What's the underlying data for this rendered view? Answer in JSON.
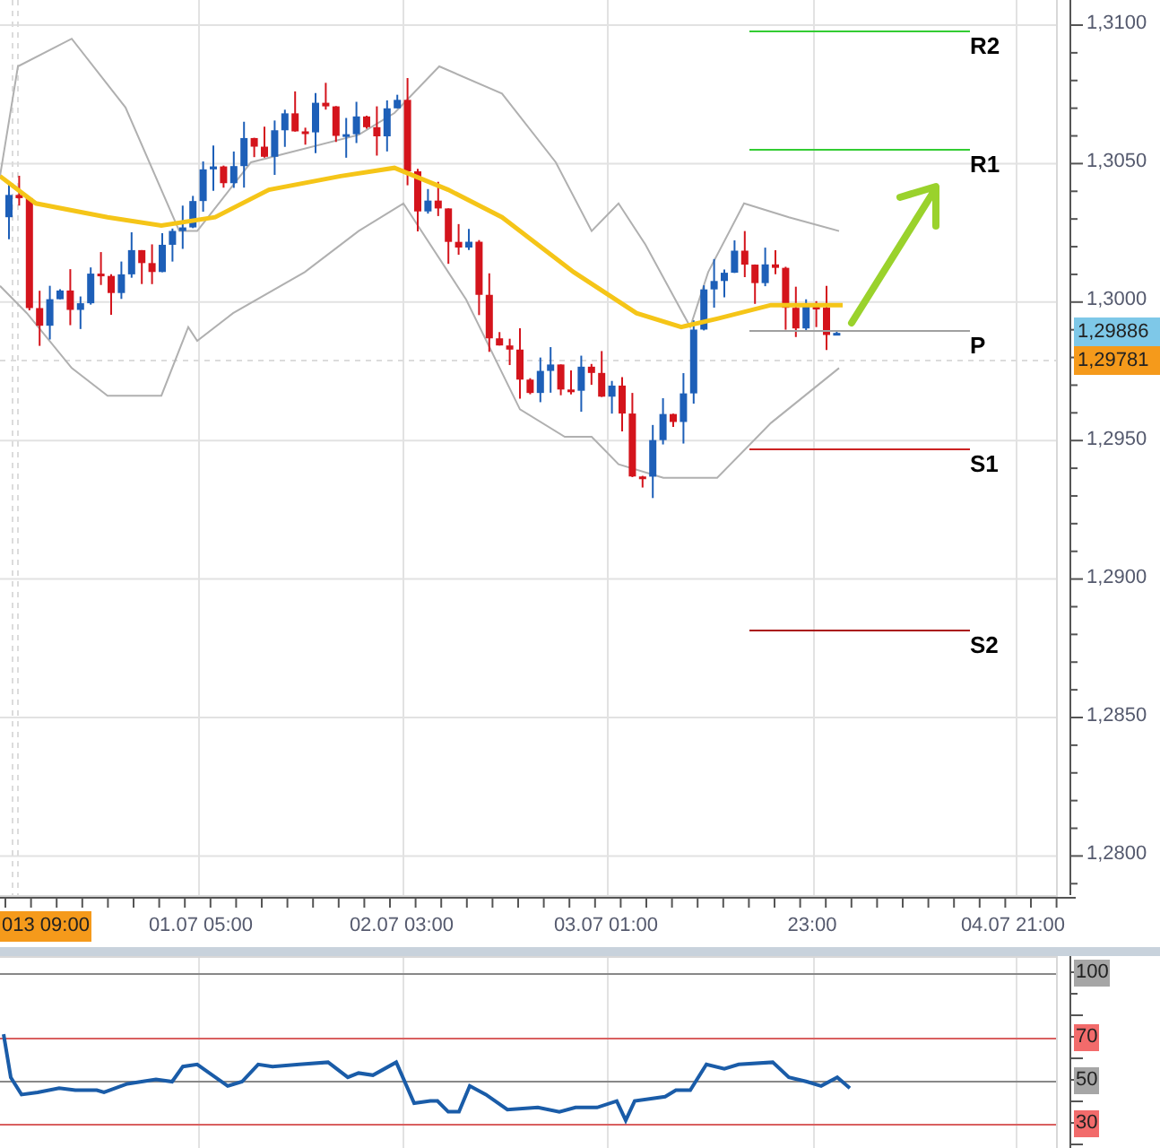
{
  "price_axis": {
    "labels": [
      "1,3100",
      "1,3050",
      "1,3000",
      "1,2950",
      "1,2900",
      "1,2850",
      "1,2800"
    ]
  },
  "price_tags": [
    {
      "text": "1,29886",
      "color": "#7ec8e8"
    },
    {
      "text": "1,29781",
      "color": "#f59a1b"
    }
  ],
  "pivot_levels": [
    {
      "label": "R2",
      "color": "#33cc33"
    },
    {
      "label": "R1",
      "color": "#33cc33"
    },
    {
      "label": "P",
      "color": "#a0a0a0"
    },
    {
      "label": "S1",
      "color": "#cc2222"
    },
    {
      "label": "S2",
      "color": "#aa1111"
    }
  ],
  "time_axis": {
    "labels": [
      {
        "text": "013 09:00",
        "selected": true
      },
      {
        "text": "01.07 05:00",
        "selected": false
      },
      {
        "text": "02.07 03:00",
        "selected": false
      },
      {
        "text": "03.07 01:00",
        "selected": false
      },
      {
        "text": "23:00",
        "selected": false
      },
      {
        "text": "04.07 21:00",
        "selected": false
      }
    ]
  },
  "rsi": {
    "labels": [
      {
        "text": "100",
        "color": "#a6a6a6"
      },
      {
        "text": "70",
        "color": "#f26b6b"
      },
      {
        "text": "50",
        "color": "#a6a6a6"
      },
      {
        "text": "30",
        "color": "#f26b6b"
      }
    ]
  }
}
